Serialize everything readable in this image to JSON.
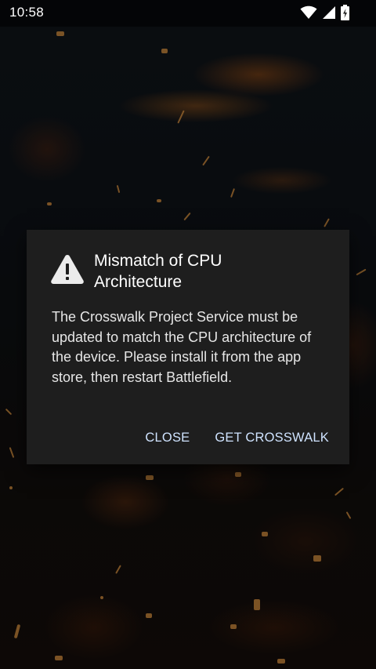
{
  "status_bar": {
    "time": "10:58",
    "icons": [
      "wifi-icon",
      "cell-signal-icon",
      "battery-charging-icon"
    ]
  },
  "dialog": {
    "icon": "warning-icon",
    "title": "Mismatch of CPU Architecture",
    "message": "The Crosswalk Project Service must be updated to match the CPU architecture of the device. Please install it from the app store, then restart Battlefield.",
    "buttons": {
      "close": "CLOSE",
      "get_crosswalk": "GET CROSSWALK"
    }
  },
  "colors": {
    "dialog_background": "#1e1e1e",
    "button_text": "#cfe3ff",
    "title_text": "#ffffff"
  }
}
